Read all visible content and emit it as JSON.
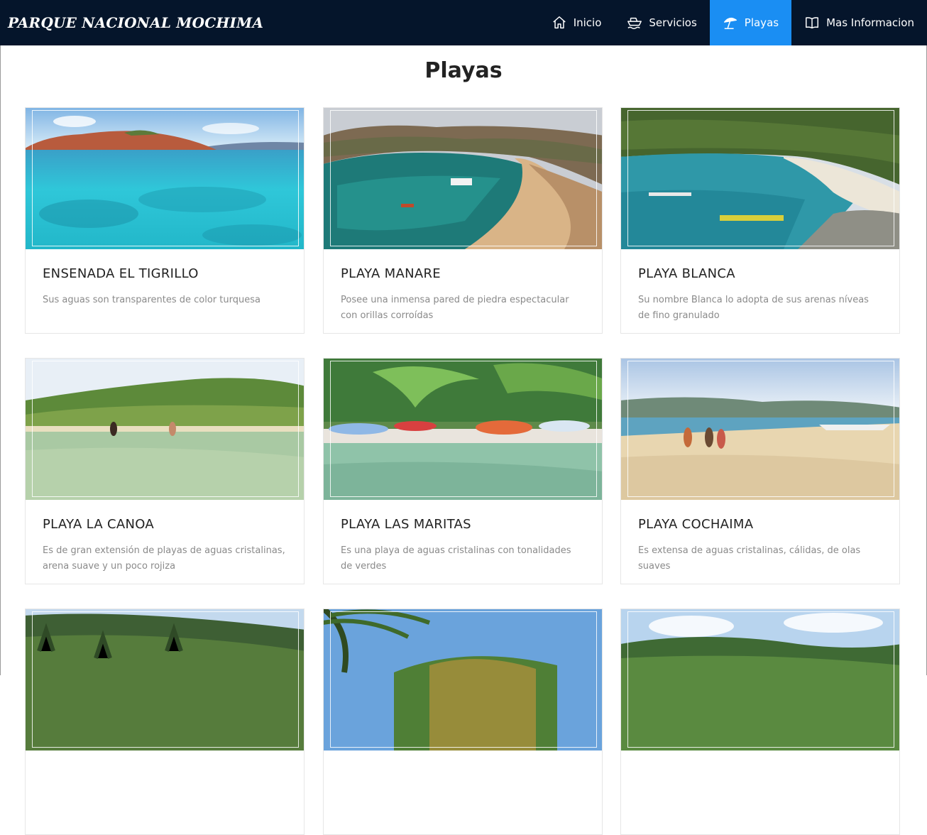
{
  "brand": "PARQUE NACIONAL MOCHIMA",
  "nav": {
    "items": [
      {
        "label": "Inicio",
        "icon": "home-icon",
        "active": false
      },
      {
        "label": "Servicios",
        "icon": "boat-icon",
        "active": false
      },
      {
        "label": "Playas",
        "icon": "beach-umbrella-icon",
        "active": true
      },
      {
        "label": "Mas Informacion",
        "icon": "book-icon",
        "active": false
      }
    ],
    "active_color": "#1a8ef3",
    "background": "#05152b"
  },
  "page_title": "Playas",
  "beaches": [
    {
      "title": "ENSENADA EL TIGRILLO",
      "description": "Sus aguas son transparentes de color turquesa"
    },
    {
      "title": "PLAYA MANARE",
      "description": "Posee una inmensa pared de piedra espectacular con orillas corroídas"
    },
    {
      "title": "PLAYA BLANCA",
      "description": "Su nombre Blanca lo adopta de sus arenas níveas de fino granulado"
    },
    {
      "title": "PLAYA LA CANOA",
      "description": "Es de gran extensión de playas de aguas cristalinas, arena suave y un poco rojiza"
    },
    {
      "title": "PLAYA LAS MARITAS",
      "description": "Es una playa de aguas cristalinas con tonalidades de verdes"
    },
    {
      "title": "PLAYA COCHAIMA",
      "description": "Es extensa de aguas cristalinas, cálidas, de olas suaves"
    },
    {
      "title": "",
      "description": ""
    },
    {
      "title": "",
      "description": ""
    },
    {
      "title": "",
      "description": ""
    }
  ]
}
